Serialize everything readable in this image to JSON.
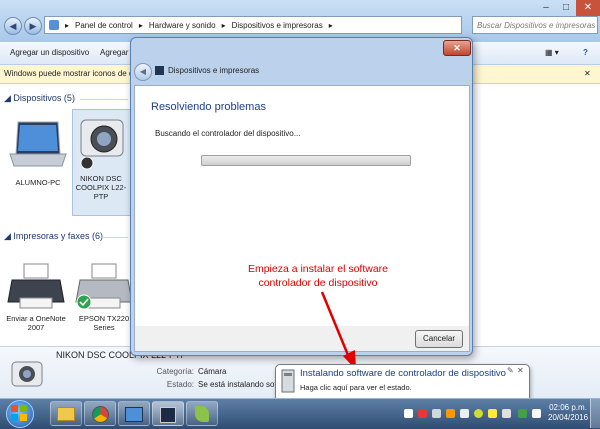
{
  "explorer": {
    "breadcrumb": [
      "Panel de control",
      "Hardware y sonido",
      "Dispositivos e impresoras"
    ],
    "search_placeholder": "Buscar Dispositivos e impresoras",
    "toolbar": {
      "add_device": "Agregar un dispositivo",
      "add_printer": "Agregar u"
    },
    "infobar": "Windows puede mostrar iconos de disp",
    "devices_header": "Dispositivos (5)",
    "devices": [
      {
        "label": "ALUMNO-PC"
      },
      {
        "label": "NIKON DSC COOLPIX L22-PTP"
      }
    ],
    "printers_header": "Impresoras y faxes (6)",
    "printers": [
      {
        "label": "Enviar a OneNote 2007"
      },
      {
        "label": "EPSON TX220 Series"
      }
    ],
    "details": {
      "device_name": "NIKON DSC COOLPIX L22-PTP",
      "category_label": "Categoría:",
      "category_value": "Cámara",
      "status_label": "Estado:",
      "status_value": "Se está instalando softw..."
    }
  },
  "dialog": {
    "title": "Dispositivos e impresoras",
    "heading": "Resolviendo problemas",
    "message": "Buscando el controlador del dispositivo...",
    "progress": 0.0,
    "cancel": "Cancelar"
  },
  "annotation": {
    "line1": "Empieza a instalar el software",
    "line2": "controlador de dispositivo",
    "color": "#e00000"
  },
  "balloon": {
    "title": "Instalando software de controlador de dispositivo",
    "subtitle": "Haga clic aquí para ver el estado."
  },
  "taskbar": {
    "time": "02:06 p.m.",
    "date": "20/04/2016"
  }
}
